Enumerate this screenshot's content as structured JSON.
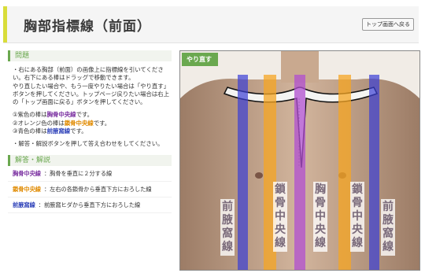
{
  "header": {
    "title": "胸部指標線（前面）",
    "top_button": "トップ画面へ戻る"
  },
  "problem": {
    "heading": "問題",
    "paragraphs": [
      "・右にある胸部（前面）の画像上に指標線を引いてください。右下にある棒はドラッグで移動できます。",
      "やり直したい場合や、もう一度やりたい場合は「やり直す」ボタンを押してください。トップページ戻りたい場合は右上の「トップ画面に戻る」ボタンを押してください。"
    ],
    "legend": {
      "purple_prefix": "①紫色の棒は",
      "purple_term": "胸骨中央線",
      "purple_suffix": "です。",
      "orange_prefix": "②オレンジ色の棒は",
      "orange_term": "鎖骨中央線",
      "orange_suffix": "です。",
      "blue_prefix": "③青色の棒は",
      "blue_term": "前腋窩線",
      "blue_suffix": "です。"
    },
    "note": "・解答・解説ボタンを押して答え合わせをしてください。"
  },
  "answer": {
    "heading": "解答・解説",
    "items": [
      {
        "term": "胸骨中央線",
        "desc": "：胸骨を垂直に２分する線"
      },
      {
        "term": "鎖骨中央線",
        "desc": "：左右の各鎖骨から垂直下方におろした線"
      },
      {
        "term": "前腋窩線",
        "desc": "：前腋窩ヒダから垂直下方におろした線"
      }
    ]
  },
  "image": {
    "redo_button": "やり直す",
    "labels": {
      "left_anterior_axillary": "前腋窩線",
      "left_midclavicular": "鎖骨中央線",
      "sternal": "胸骨中央線",
      "right_midclavicular": "鎖骨中央線",
      "right_anterior_axillary": "前腋窩線"
    }
  },
  "colors": {
    "accent_green": "#6aa84f",
    "header_bar": "#d9dd3a",
    "sternal_line": "#b04fd0",
    "midclavicular_line": "#f5a623",
    "axillary_line": "#3a3fd6"
  }
}
